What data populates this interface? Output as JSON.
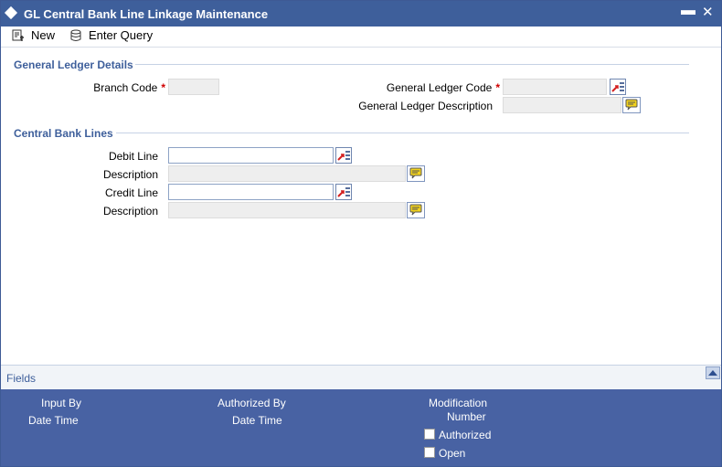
{
  "window": {
    "title": "GL Central Bank Line Linkage Maintenance",
    "minimize_icon": "minimize-icon",
    "close_icon": "close-icon"
  },
  "toolbar": {
    "new_label": "New",
    "enter_query_label": "Enter Query"
  },
  "general_ledger_details": {
    "section_title": "General Ledger Details",
    "branch_code_label": "Branch Code",
    "branch_code_value": "",
    "gl_code_label": "General Ledger Code",
    "gl_code_value": "",
    "gl_description_label": "General Ledger Description",
    "gl_description_value": "",
    "required_marker": "*"
  },
  "central_bank_lines": {
    "section_title": "Central Bank Lines",
    "debit_line_label": "Debit Line",
    "debit_line_value": "",
    "debit_description_label": "Description",
    "debit_description_value": "",
    "credit_line_label": "Credit Line",
    "credit_line_value": "",
    "credit_description_label": "Description",
    "credit_description_value": ""
  },
  "footer": {
    "fields_label": "Fields",
    "input_by_label": "Input By",
    "date_time_label_1": "Date Time",
    "authorized_by_label": "Authorized By",
    "date_time_label_2": "Date Time",
    "modification_label": "Modification",
    "number_label": "Number",
    "authorized_checkbox_label": "Authorized",
    "open_checkbox_label": "Open",
    "authorized_checked": false,
    "open_checked": false
  },
  "colors": {
    "title_bar": "#3e5f9b",
    "audit_panel": "#4862a3",
    "section_title": "#3e5f9b",
    "required": "#d00000"
  }
}
